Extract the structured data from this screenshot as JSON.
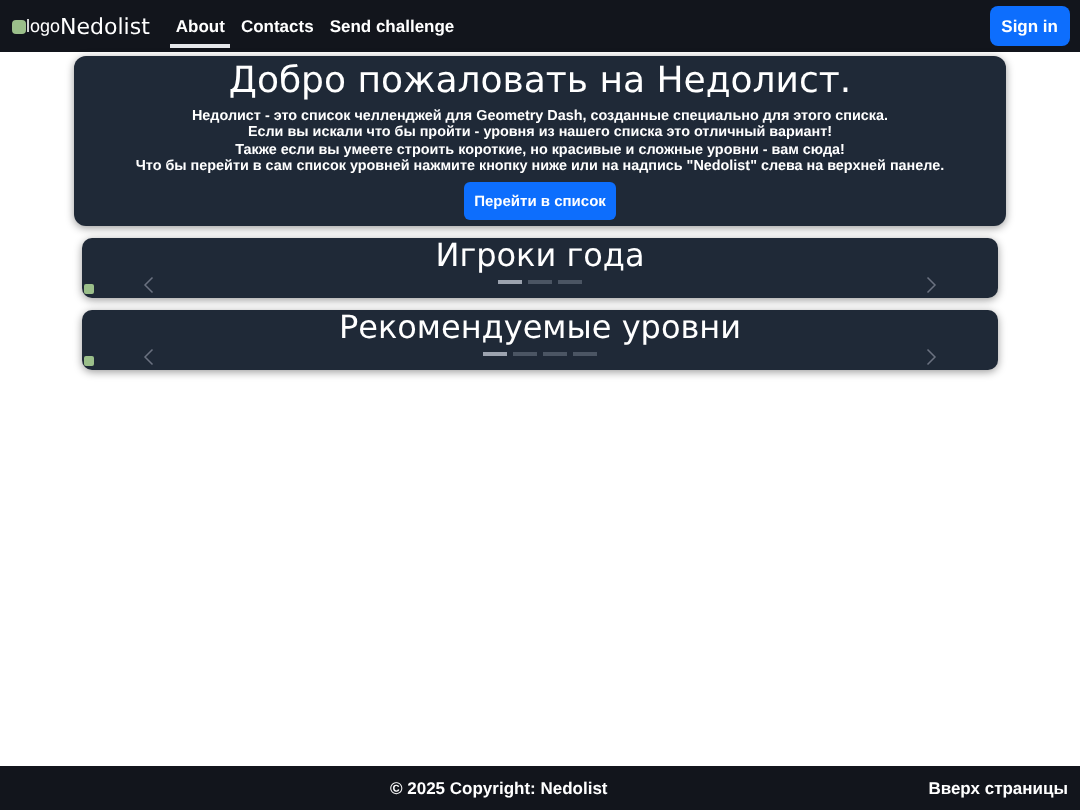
{
  "navbar": {
    "logo_alt": "logo",
    "brand": "Nedolist",
    "links": [
      {
        "label": "About",
        "selected": true
      },
      {
        "label": "Contacts",
        "selected": false
      },
      {
        "label": "Send challenge",
        "selected": false
      }
    ],
    "sign_in": "Sign in"
  },
  "hero": {
    "title": "Добро пожаловать на Недолист.",
    "lines": [
      "Недолист - это список челленджей для Geometry Dash, созданные специально для этого списка.",
      "Если вы искали что бы пройти - уровня из нашего списка это отличный вариант!",
      "Также если вы умеете строить короткие, но красивые и сложные уровни - вам сюда!",
      "Что бы перейти в сам список уровней нажмите кнопку ниже или на надпись \"Nedolist\" слева на верхней панеле."
    ],
    "button": "Перейти в список"
  },
  "carousels": [
    {
      "title": "Игроки года",
      "indicators": [
        {
          "selected": true
        },
        {
          "selected": false
        },
        {
          "selected": false
        }
      ]
    },
    {
      "title": "Рекомендуемые уровни",
      "indicators": [
        {
          "selected": true
        },
        {
          "selected": false
        },
        {
          "selected": false
        },
        {
          "selected": false
        }
      ]
    }
  ],
  "footer": {
    "copyright": "© 2025 Copyright: Nedolist",
    "top_link": "Вверх страницы"
  }
}
